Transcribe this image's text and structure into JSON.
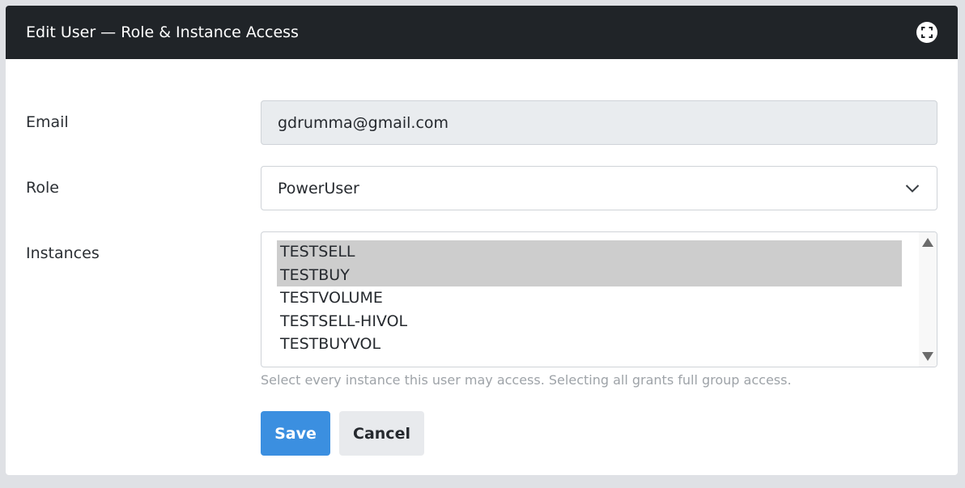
{
  "modal": {
    "title": "Edit User — Role & Instance Access",
    "expand_icon": "expand-icon"
  },
  "form": {
    "email_label": "Email",
    "email_value": "gdrumma@gmail.com",
    "role_label": "Role",
    "role_value": "PowerUser",
    "role_icon": "chevron-down-icon",
    "instances_label": "Instances",
    "instances": [
      {
        "label": "TESTSELL",
        "selected": true
      },
      {
        "label": "TESTBUY",
        "selected": true
      },
      {
        "label": "TESTVOLUME",
        "selected": false
      },
      {
        "label": "TESTSELL-HIVOL",
        "selected": false
      },
      {
        "label": "TESTBUYVOL",
        "selected": false
      }
    ],
    "instances_help": "Select every instance this user may access. Selecting all grants full group access."
  },
  "actions": {
    "save_label": "Save",
    "cancel_label": "Cancel"
  },
  "colors": {
    "header_bg": "#202428",
    "primary": "#3b8fe0",
    "selected_bg": "#cdcdcd"
  }
}
